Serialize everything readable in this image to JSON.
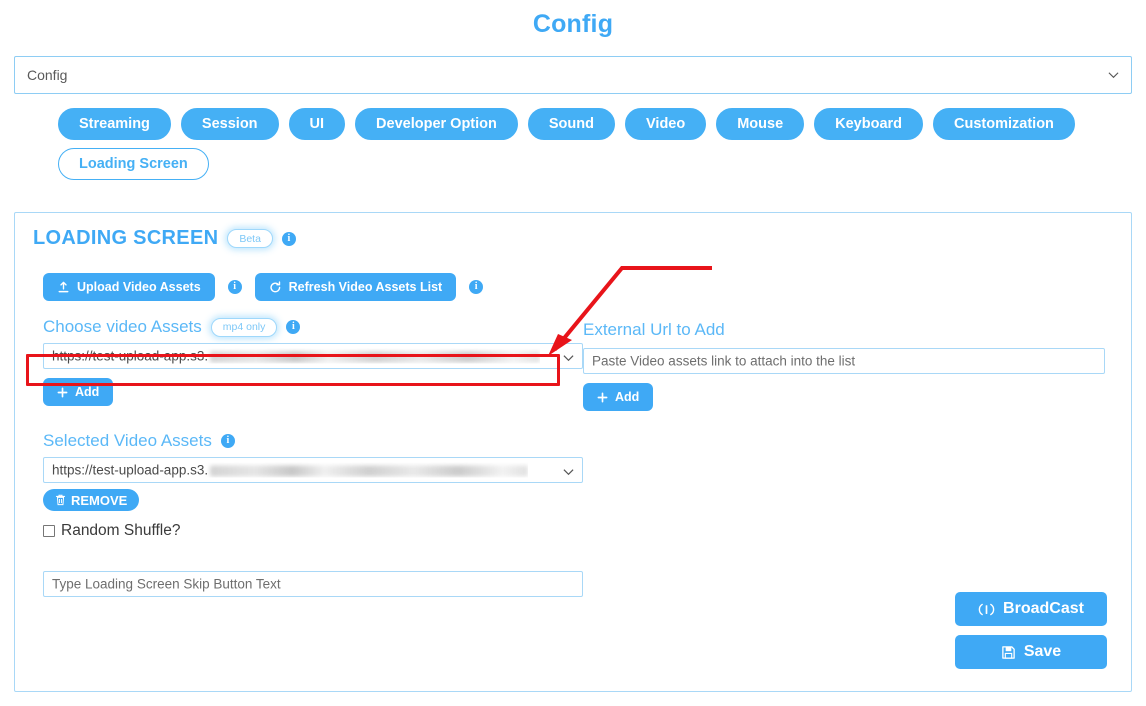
{
  "page": {
    "title": "Config"
  },
  "config_select": {
    "value": "Config",
    "caret_icon": "chevron-down-icon"
  },
  "tabs": [
    {
      "label": "Streaming",
      "active": false
    },
    {
      "label": "Session",
      "active": false
    },
    {
      "label": "UI",
      "active": false
    },
    {
      "label": "Developer Option",
      "active": false
    },
    {
      "label": "Sound",
      "active": false
    },
    {
      "label": "Video",
      "active": false
    },
    {
      "label": "Mouse",
      "active": false
    },
    {
      "label": "Keyboard",
      "active": false
    },
    {
      "label": "Customization",
      "active": false
    },
    {
      "label": "Loading Screen",
      "active": true
    }
  ],
  "panel": {
    "heading": "LOADING SCREEN",
    "heading_badge": "Beta",
    "upload_button": "Upload Video Assets",
    "refresh_button": "Refresh Video Assets List",
    "choose_label": "Choose video Assets",
    "choose_badge": "mp4 only",
    "choose_select_value": "https://test-upload-app.s3.",
    "choose_add_button": "Add",
    "external_label": "External Url to Add",
    "external_placeholder": "Paste Video assets link to attach into the list",
    "external_add_button": "Add",
    "selected_label": "Selected Video Assets",
    "selected_select_value": "https://test-upload-app.s3.",
    "remove_button": "REMOVE",
    "random_shuffle_label": "Random Shuffle?",
    "random_shuffle_checked": false,
    "skip_text_placeholder": "Type Loading Screen Skip Button Text",
    "broadcast_button": "BroadCast",
    "save_button": "Save"
  },
  "icons": {
    "info": "i",
    "upload": "upload-icon",
    "refresh": "refresh-icon",
    "plus": "plus-icon",
    "trash": "trash-icon",
    "broadcast": "broadcast-tower-icon",
    "save": "floppy-disk-icon"
  },
  "colors": {
    "accent": "#3fa9f5",
    "tab": "#45b0f5",
    "border": "#a9d8f7",
    "annotation": "#e8141a"
  }
}
